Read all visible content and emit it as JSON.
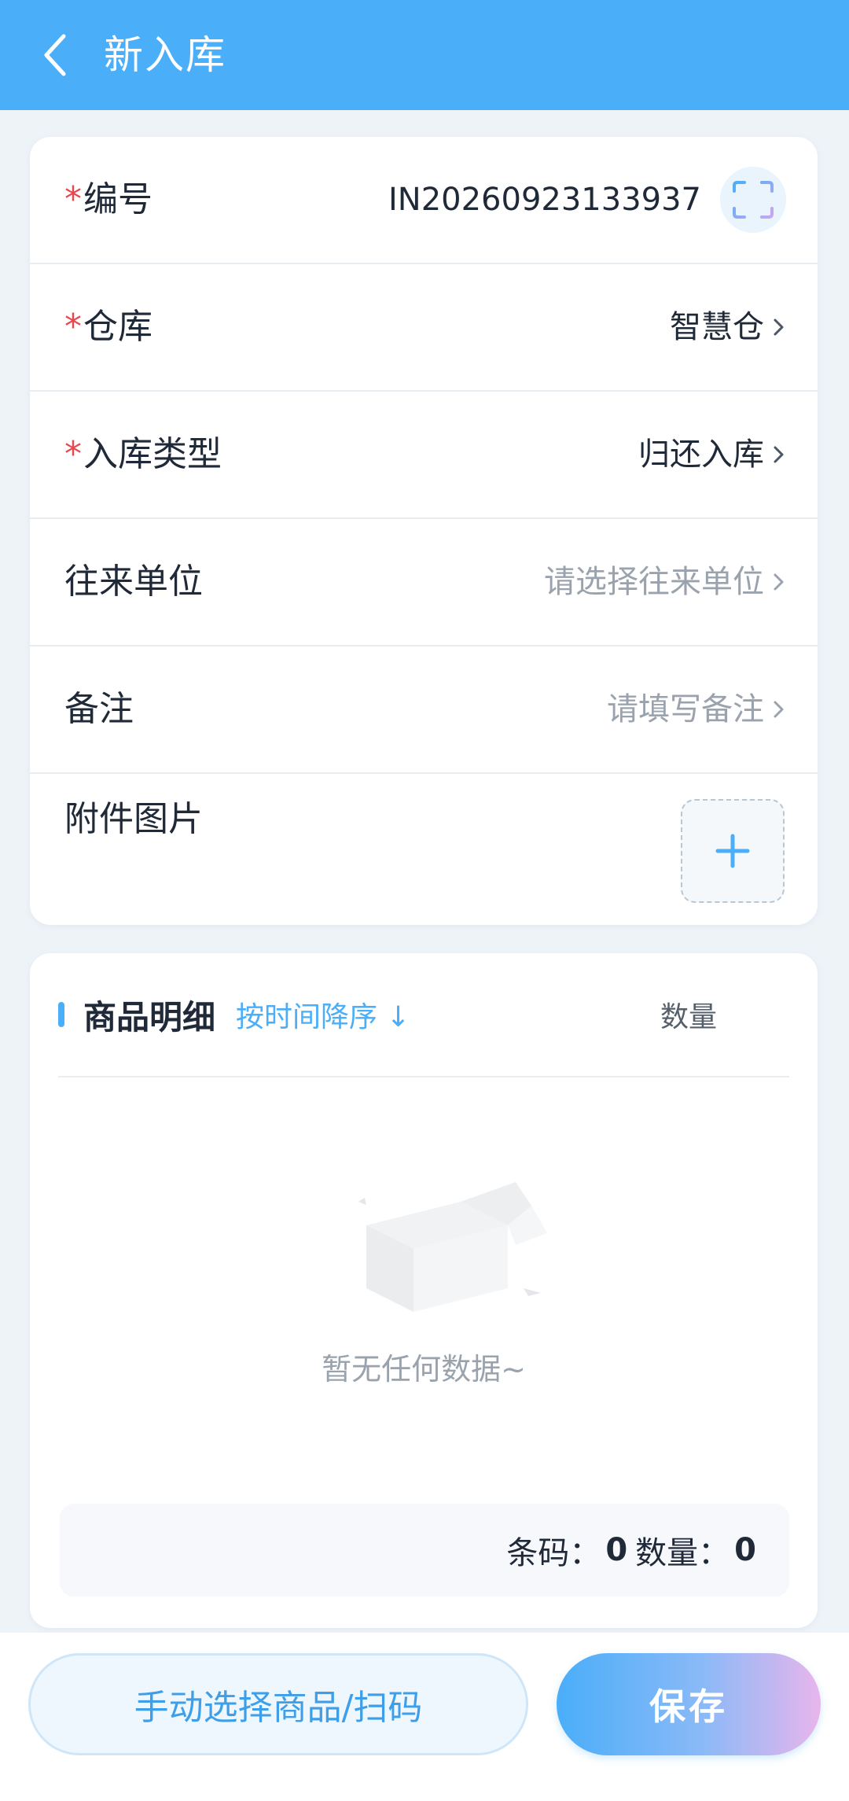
{
  "header": {
    "title": "新入库"
  },
  "form": {
    "code": {
      "label": "编号",
      "value": "IN20260923133937"
    },
    "warehouse": {
      "label": "仓库",
      "value": "智慧仓"
    },
    "type": {
      "label": "入库类型",
      "value": "归还入库"
    },
    "partner": {
      "label": "往来单位",
      "placeholder": "请选择往来单位"
    },
    "remark": {
      "label": "备注",
      "placeholder": "请填写备注"
    },
    "attachments": {
      "label": "附件图片"
    },
    "required_mark": "*"
  },
  "goods": {
    "title": "商品明细",
    "sort_label": "按时间降序",
    "sort_arrow": "↓",
    "qty_column": "数量",
    "empty_text": "暂无任何数据~",
    "summary": {
      "barcode_label": "条码：",
      "barcode_value": "0",
      "qty_label": "数量：",
      "qty_value": "0"
    }
  },
  "footer": {
    "manual_button": "手动选择商品/扫码",
    "save_button": "保存"
  },
  "colors": {
    "primary": "#4aaef9",
    "required": "#e5484d",
    "placeholder": "#9aa3ad"
  }
}
